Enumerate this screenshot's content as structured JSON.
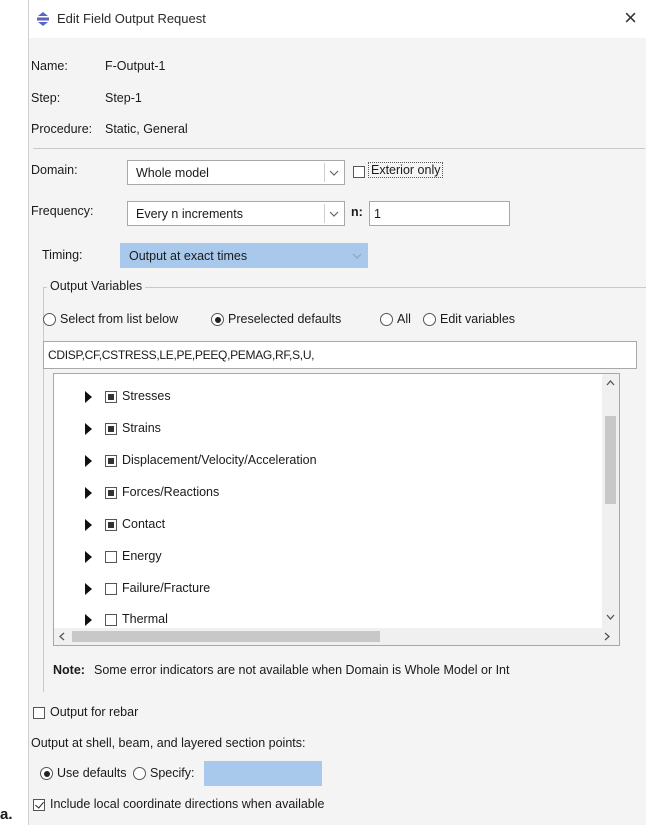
{
  "figure_label": "a.",
  "dialog": {
    "title": "Edit Field Output Request",
    "close_glyph": "×",
    "accent_color": "#5b63c6",
    "info": {
      "name_label": "Name:",
      "name_value": "F-Output-1",
      "step_label": "Step:",
      "step_value": "Step-1",
      "procedure_label": "Procedure:",
      "procedure_value": "Static, General"
    },
    "domain": {
      "label": "Domain:",
      "value": "Whole model",
      "exterior_label": "Exterior only",
      "exterior_checked": false
    },
    "frequency": {
      "label": "Frequency:",
      "value": "Every n increments",
      "n_label": "n:",
      "n_value": "1"
    },
    "timing": {
      "label": "Timing:",
      "value": "Output at exact times",
      "disabled_color": "#a8c9ec"
    },
    "output_variables": {
      "group_label": "Output Variables",
      "radio_options": [
        {
          "label": "Select from list below",
          "selected": false
        },
        {
          "label": "Preselected defaults",
          "selected": true
        },
        {
          "label": "All",
          "selected": false
        },
        {
          "label": "Edit variables",
          "selected": false
        }
      ],
      "variables_text": "CDISP,CF,CSTRESS,LE,PE,PEEQ,PEMAG,RF,S,U,",
      "tree_items": [
        {
          "label": "Stresses",
          "state": "partial"
        },
        {
          "label": "Strains",
          "state": "partial"
        },
        {
          "label": "Displacement/Velocity/Acceleration",
          "state": "partial"
        },
        {
          "label": "Forces/Reactions",
          "state": "partial"
        },
        {
          "label": "Contact",
          "state": "partial"
        },
        {
          "label": "Energy",
          "state": "unchecked"
        },
        {
          "label": "Failure/Fracture",
          "state": "unchecked"
        },
        {
          "label": "Thermal",
          "state": "unchecked"
        }
      ],
      "note_label": "Note:",
      "note_text": "Some error indicators are not available when Domain is Whole Model or Int"
    },
    "rebar": {
      "label": "Output for rebar",
      "checked": false
    },
    "section_points": {
      "label": "Output at shell, beam, and layered section points:",
      "options": [
        {
          "label": "Use defaults",
          "selected": true
        },
        {
          "label": "Specify:",
          "selected": false
        }
      ]
    },
    "local_coords": {
      "label": "Include local coordinate directions when available",
      "checked": true
    }
  }
}
